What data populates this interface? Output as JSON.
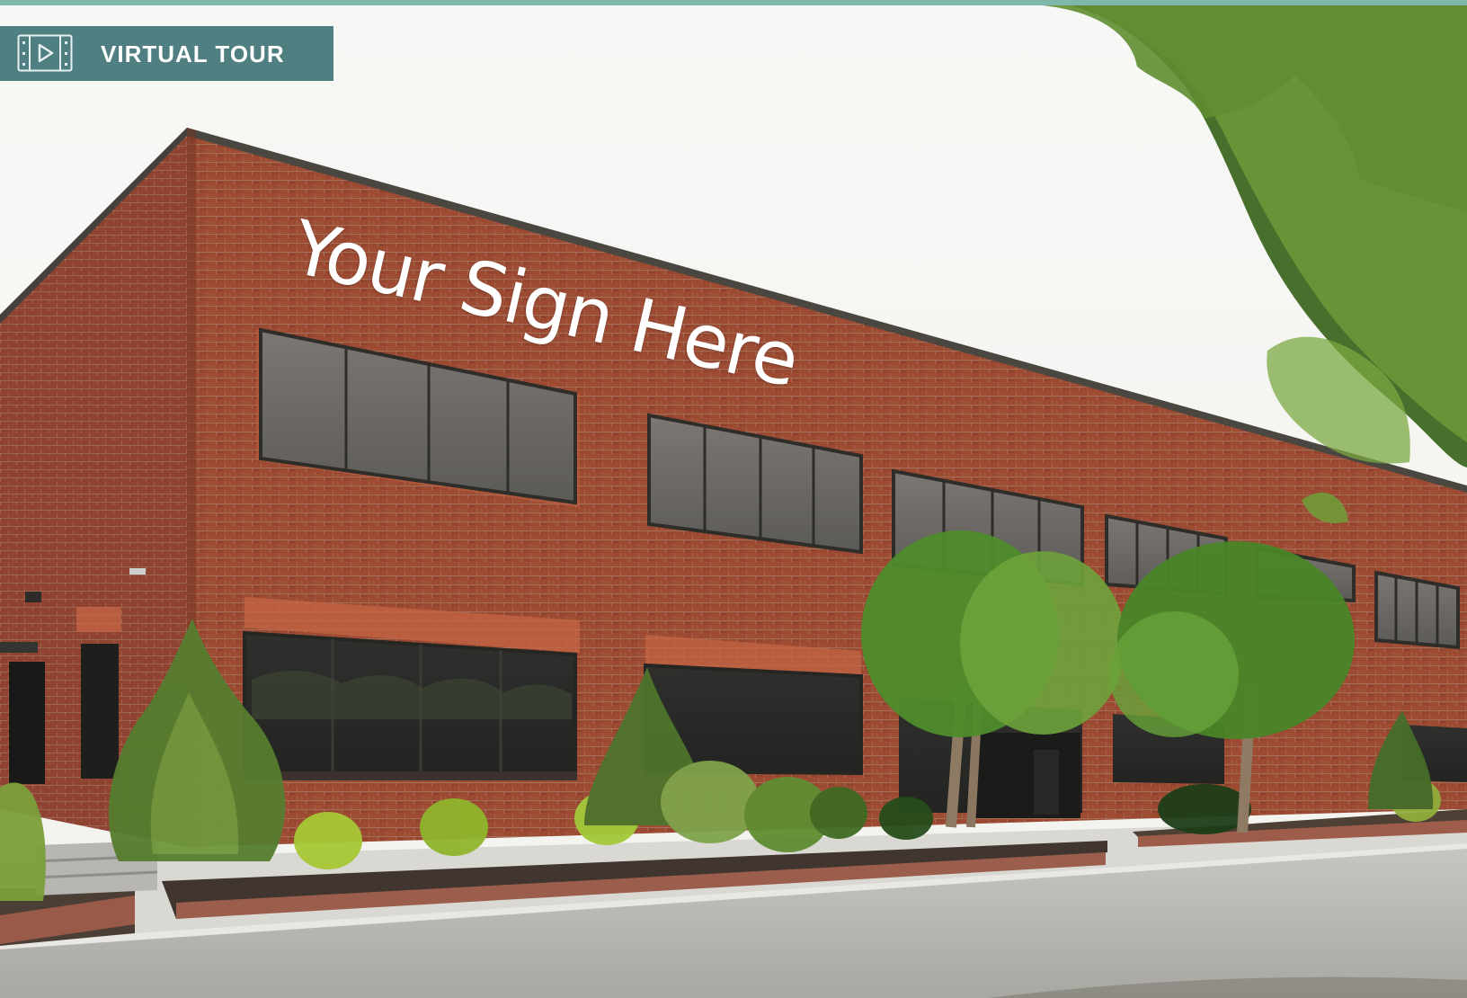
{
  "virtual_tour": {
    "label": "VIRTUAL TOUR",
    "icon": "video-play-icon"
  },
  "photo": {
    "sign_text": "Your Sign Here"
  },
  "colors": {
    "accent": "#7fb7a9",
    "tour_button": "#4f7f80",
    "brick": "#9c4a32"
  }
}
